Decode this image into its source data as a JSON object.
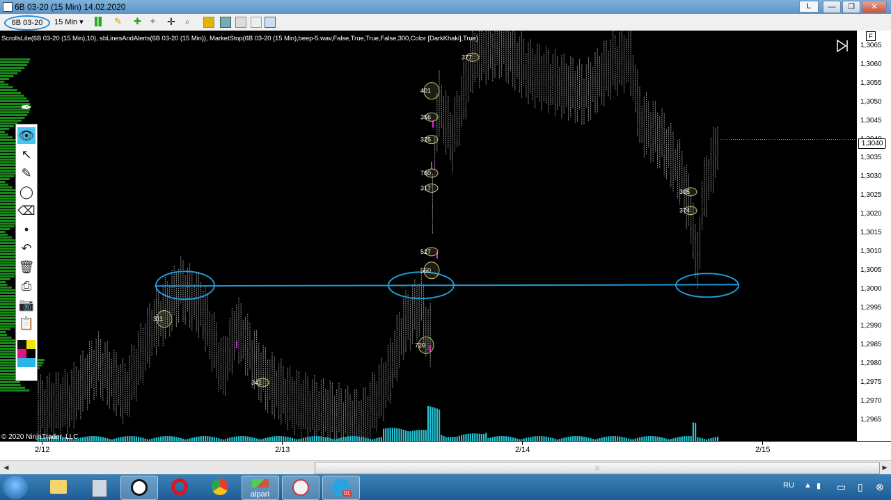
{
  "window": {
    "title": "6B 03-20 (15 Min)  14.02.2020",
    "badge": "L",
    "minimize": "—",
    "maximize": "❐",
    "close": "✕"
  },
  "toolbar": {
    "instrument": "6B 03-20",
    "timeframe": "15 Min ▾"
  },
  "chart": {
    "indicators_text": "ScrollsLite(6B 03-20 (15 Min),10), sbLinesAndAlerts(6B 03-20 (15 Min)), MarketStop(6B 03-20 (15 Min),beep-5.wav,False,True,True,False,300,Color [DarkKhaki],True)",
    "copyright": "© 2020 NinjaTrader, LLC",
    "f_button": "F",
    "current_price": "1,3040",
    "level_colors": {
      "line": "#1e9ad8",
      "bar": "#909090",
      "volume": "#27c4d4",
      "ellipse": "#c8c07a"
    }
  },
  "chart_data": {
    "type": "bar",
    "price_ticks": [
      "1,3065",
      "1,3060",
      "1,3055",
      "1,3050",
      "1,3045",
      "1,3040",
      "1,3035",
      "1,3030",
      "1,3025",
      "1,3020",
      "1,3015",
      "1,3010",
      "1,3005",
      "1,3000",
      "1,2995",
      "1,2990",
      "1,2985",
      "1,2980",
      "1,2975",
      "1,2970",
      "1,2965"
    ],
    "time_ticks": [
      "2/12",
      "2/13",
      "2/14",
      "2/15"
    ],
    "ylim": [
      1.2962,
      1.3068
    ],
    "horizontal_level": 1.3001,
    "volume_labels": [
      {
        "text": "311",
        "price": 1.2992,
        "t": 0.19
      },
      {
        "text": "341",
        "price": 1.2975,
        "t": 0.31
      },
      {
        "text": "377",
        "price": 1.3062,
        "t": 0.56
      },
      {
        "text": "401",
        "price": 1.3053,
        "t": 0.51
      },
      {
        "text": "356",
        "price": 1.3046,
        "t": 0.51
      },
      {
        "text": "325",
        "price": 1.304,
        "t": 0.51
      },
      {
        "text": "760",
        "price": 1.3031,
        "t": 0.51
      },
      {
        "text": "317",
        "price": 1.3027,
        "t": 0.51
      },
      {
        "text": "527",
        "price": 1.301,
        "t": 0.51
      },
      {
        "text": "560",
        "price": 1.3005,
        "t": 0.51
      },
      {
        "text": "720",
        "price": 1.2985,
        "t": 0.51
      },
      {
        "text": "305",
        "price": 1.3026,
        "t": 0.81
      },
      {
        "text": "374",
        "price": 1.3021,
        "t": 0.81
      }
    ]
  },
  "drawing_tools": [
    {
      "name": "eye-icon",
      "glyph": "👁"
    },
    {
      "name": "pointer-icon",
      "glyph": "↖"
    },
    {
      "name": "pencil-icon",
      "glyph": "✎"
    },
    {
      "name": "circle-icon",
      "glyph": "◯"
    },
    {
      "name": "eraser-icon",
      "glyph": "⌫"
    },
    {
      "name": "dot-icon",
      "glyph": "•"
    },
    {
      "name": "undo-icon",
      "glyph": "↶"
    },
    {
      "name": "trash-icon",
      "glyph": "🗑"
    },
    {
      "name": "printer-icon",
      "glyph": "⎙"
    },
    {
      "name": "camera-icon",
      "glyph": "📷"
    },
    {
      "name": "clipboard-icon",
      "glyph": "📋"
    }
  ],
  "taskbar": {
    "apps": [
      "start",
      "explorer",
      "calculator",
      "ninjatrader",
      "opera",
      "chrome",
      "alpari",
      "lightning",
      "telegram"
    ],
    "alpari_label": "alpari",
    "telegram_badge": "01",
    "lang": "RU"
  }
}
